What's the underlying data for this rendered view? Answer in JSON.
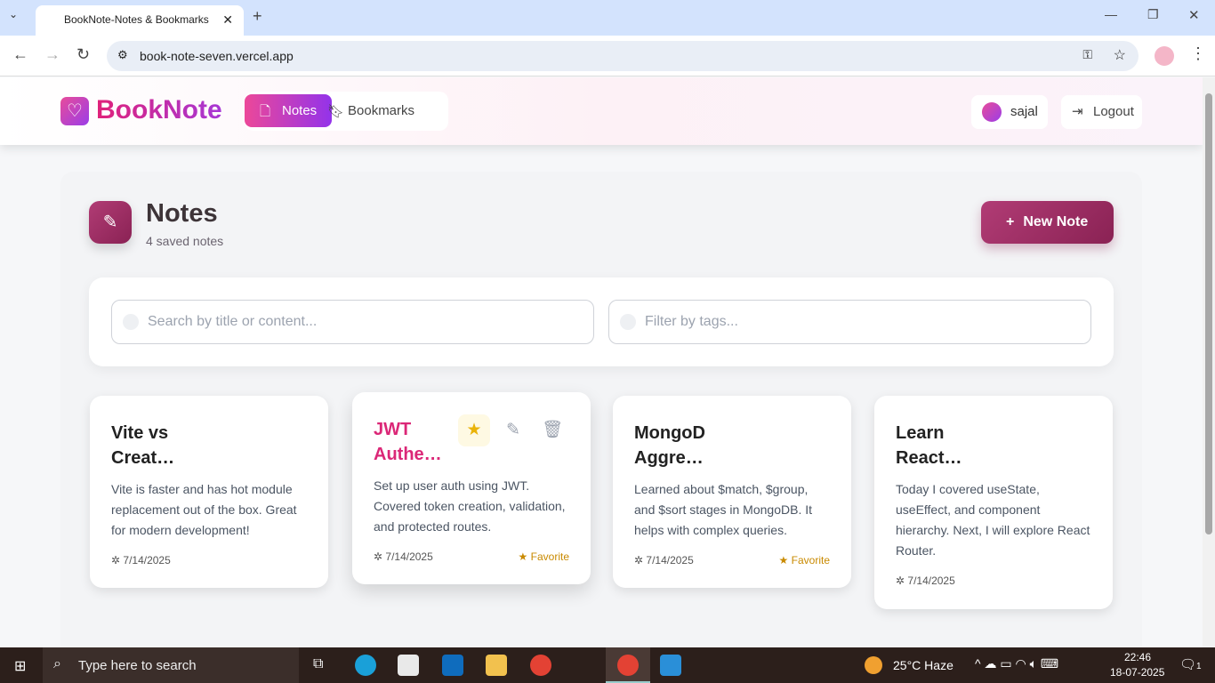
{
  "browser": {
    "tab_title": "BookNote-Notes & Bookmarks",
    "url": "book-note-seven.vercel.app"
  },
  "header": {
    "logo": "BookNote",
    "nav": [
      {
        "label": "Notes",
        "active": true
      },
      {
        "label": "Bookmarks",
        "active": false
      }
    ],
    "user": "sajal",
    "logout": "Logout"
  },
  "main": {
    "title": "Notes",
    "subtitle": "4 saved notes",
    "new_note": "New Note",
    "search_placeholder": "Search by title or content...",
    "tags_placeholder": "Filter by tags...",
    "notes": [
      {
        "title": "Vite vs Creat…",
        "body": "Vite is faster and has hot module replacement out of the box. Great for modern development!",
        "date": "7/14/2025",
        "favorite": false
      },
      {
        "title": "JWT Authe…",
        "body": "Set up user auth using JWT. Covered token creation, validation, and protected routes.",
        "date": "7/14/2025",
        "favorite": true,
        "favorite_label": "Favorite",
        "hovered": true
      },
      {
        "title": "MongoD Aggre…",
        "body": "Learned about $match, $group, and $sort stages in MongoDB. It helps with complex queries.",
        "date": "7/14/2025",
        "favorite": true,
        "favorite_label": "Favorite"
      },
      {
        "title": "Learn React…",
        "body": "Today I covered useState, useEffect, and component hierarchy. Next, I will explore React Router.",
        "date": "7/14/2025",
        "favorite": false
      }
    ]
  },
  "colors": {
    "brand_pink": "#ec4899",
    "brand_purple": "#9333ea",
    "primary": "#a3336b",
    "favorite": "#c98a00"
  },
  "taskbar": {
    "search": "Type here to search",
    "weather": "25°C  Haze",
    "time": "22:46",
    "date": "18-07-2025",
    "notif_count": "1"
  }
}
